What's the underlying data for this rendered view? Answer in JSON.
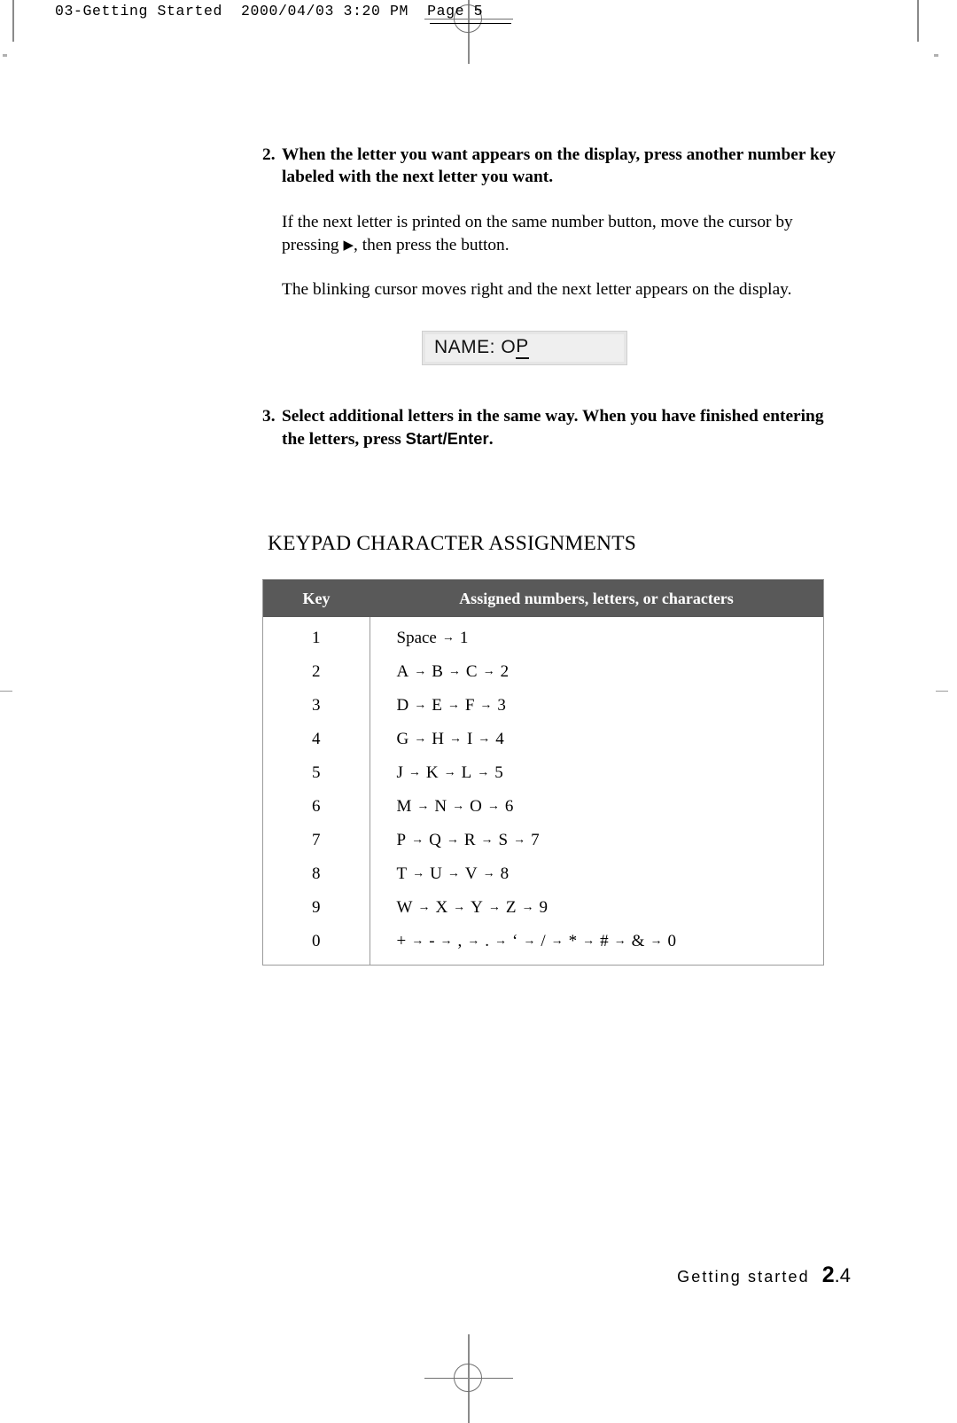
{
  "page_header": "03-Getting Started  2000/04/03 3:20 PM  Page 5",
  "steps": [
    {
      "number": "2.",
      "text": "When the letter you want appears on the display, press another number key labeled with the next letter you want."
    },
    {
      "number": "3.",
      "text_before": "Select additional letters in the same way. When you have finished entering the letters, press ",
      "emphasis": "Start/Enter",
      "text_after": "."
    }
  ],
  "paragraphs": {
    "same_button_before": "If the next letter is printed on the same number button, move the cursor by pressing ",
    "same_button_arrow": "▶",
    "same_button_after": ", then press the button.",
    "cursor_moves": "The blinking cursor moves right and the next letter appears on the display."
  },
  "display": {
    "label": "NAME: O",
    "cursor_char": "P"
  },
  "section": {
    "title": "KEYPAD CHARACTER ASSIGNMENTS"
  },
  "table": {
    "headers": {
      "key": "Key",
      "assigned": "Assigned numbers, letters, or characters"
    },
    "arrow": "→",
    "rows": [
      {
        "key": "1",
        "sequence": [
          "Space",
          "1"
        ]
      },
      {
        "key": "2",
        "sequence": [
          "A",
          "B",
          "C",
          "2"
        ]
      },
      {
        "key": "3",
        "sequence": [
          "D",
          "E",
          "F",
          "3"
        ]
      },
      {
        "key": "4",
        "sequence": [
          "G",
          "H",
          "I",
          "4"
        ]
      },
      {
        "key": "5",
        "sequence": [
          "J",
          "K",
          "L",
          "5"
        ]
      },
      {
        "key": "6",
        "sequence": [
          "M",
          "N",
          "O",
          "6"
        ]
      },
      {
        "key": "7",
        "sequence": [
          "P",
          "Q",
          "R",
          "S",
          "7"
        ]
      },
      {
        "key": "8",
        "sequence": [
          "T",
          "U",
          "V",
          "8"
        ]
      },
      {
        "key": "9",
        "sequence": [
          "W",
          "X",
          "Y",
          "Z",
          "9"
        ]
      },
      {
        "key": "0",
        "sequence": [
          "+",
          "-",
          ",",
          ".",
          "‘",
          "/",
          "*",
          "#",
          "&",
          "0"
        ]
      }
    ]
  },
  "footer": {
    "label": "Getting started",
    "page_major": "2",
    "page_minor": ".4"
  },
  "colors": {
    "table_header_bg": "#595959",
    "table_border": "#9b9b9b",
    "lcd_bg": "#efefef",
    "lcd_frame": "#e6e6e6"
  }
}
